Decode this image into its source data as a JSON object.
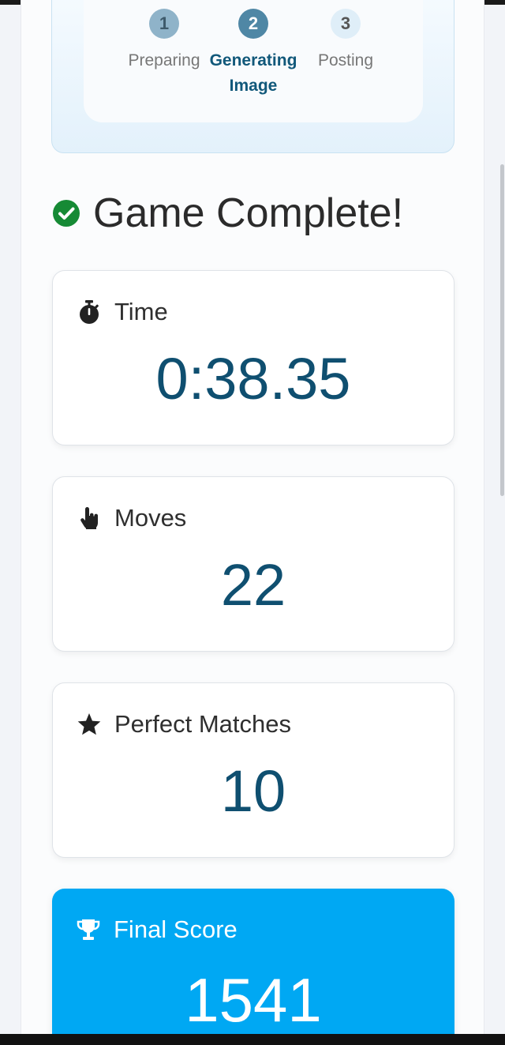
{
  "progress": {
    "steps": [
      {
        "number": "1",
        "label": "Preparing",
        "state": "done"
      },
      {
        "number": "2",
        "label_line1": "Generating",
        "label_line2": "Image",
        "state": "active"
      },
      {
        "number": "3",
        "label": "Posting",
        "state": "pending"
      }
    ]
  },
  "heading": {
    "title": "Game Complete!",
    "icon": "check-circle-icon"
  },
  "stats": {
    "time": {
      "label": "Time",
      "value": "0:38.35",
      "icon": "stopwatch-icon"
    },
    "moves": {
      "label": "Moves",
      "value": "22",
      "icon": "pointer-hand-icon"
    },
    "perfect": {
      "label": "Perfect Matches",
      "value": "10",
      "icon": "star-icon"
    },
    "score": {
      "label": "Final Score",
      "value": "1541",
      "icon": "trophy-icon"
    }
  },
  "colors": {
    "accent": "#00a8f3",
    "value_text": "#0f4f70",
    "success": "#168a35",
    "active_step": "#4f87a5"
  }
}
